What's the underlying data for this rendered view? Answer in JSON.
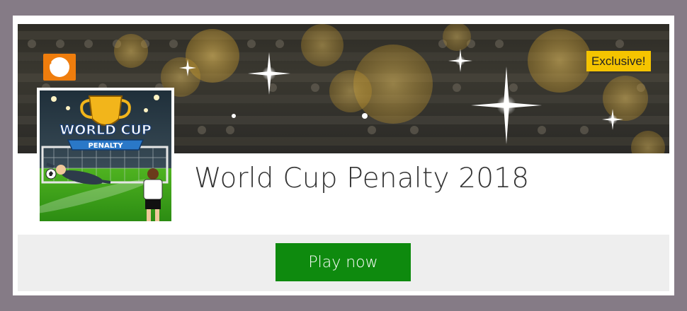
{
  "game": {
    "title": "World Cup Penalty 2018",
    "badge": "Exclusive!",
    "thumbnail_logo_line1": "WORLD CUP",
    "thumbnail_logo_line2": "PENALTY"
  },
  "actions": {
    "play_label": "Play now",
    "back_icon": "chevron-left-icon"
  },
  "colors": {
    "page_background": "#857b86",
    "back_button": "#ef7d0d",
    "badge": "#f5c400",
    "play_button": "#0e8a0e",
    "strip": "#eeeeee"
  }
}
